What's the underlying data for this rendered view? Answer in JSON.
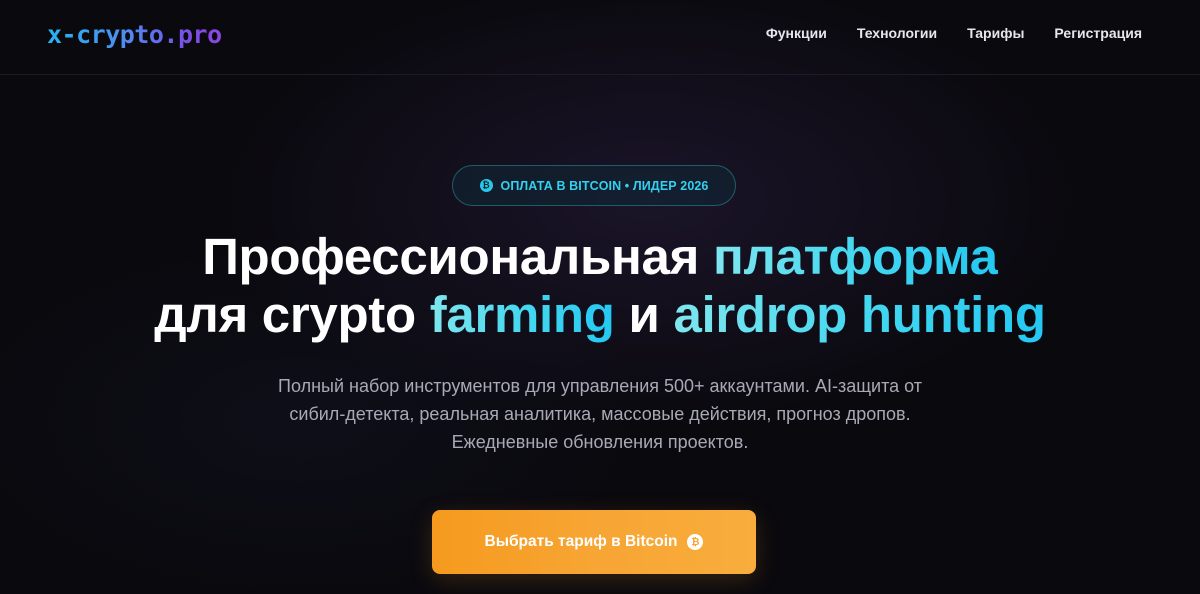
{
  "header": {
    "logo": "x-crypto.pro",
    "nav": [
      {
        "label": "Функции"
      },
      {
        "label": "Технологии"
      },
      {
        "label": "Тарифы"
      },
      {
        "label": "Регистрация"
      }
    ]
  },
  "hero": {
    "badge": {
      "icon": "bitcoin-icon",
      "text": "ОПЛАТА В BITCOIN • ЛИДЕР 2026"
    },
    "headline": {
      "line1_white": "Профессиональная ",
      "line1_accent": "платформа",
      "line2_white_1": "для crypto ",
      "line2_accent_1": "farming",
      "line2_white_2": " и ",
      "line2_accent_2": "airdrop hunting"
    },
    "subtitle": "Полный набор инструментов для управления 500+ аккаунтами. AI-защита от сибил-детекта, реальная аналитика, массовые действия, прогноз дропов. Ежедневные обновления проектов.",
    "cta": {
      "label": "Выбрать тариф в Bitcoin",
      "icon": "bitcoin-icon"
    }
  },
  "colors": {
    "background": "#0a090e",
    "accent_cyan": "#23c8f2",
    "cta_orange": "#f7a534",
    "logo_gradient": [
      "#27b4f0",
      "#8a46e0"
    ]
  }
}
